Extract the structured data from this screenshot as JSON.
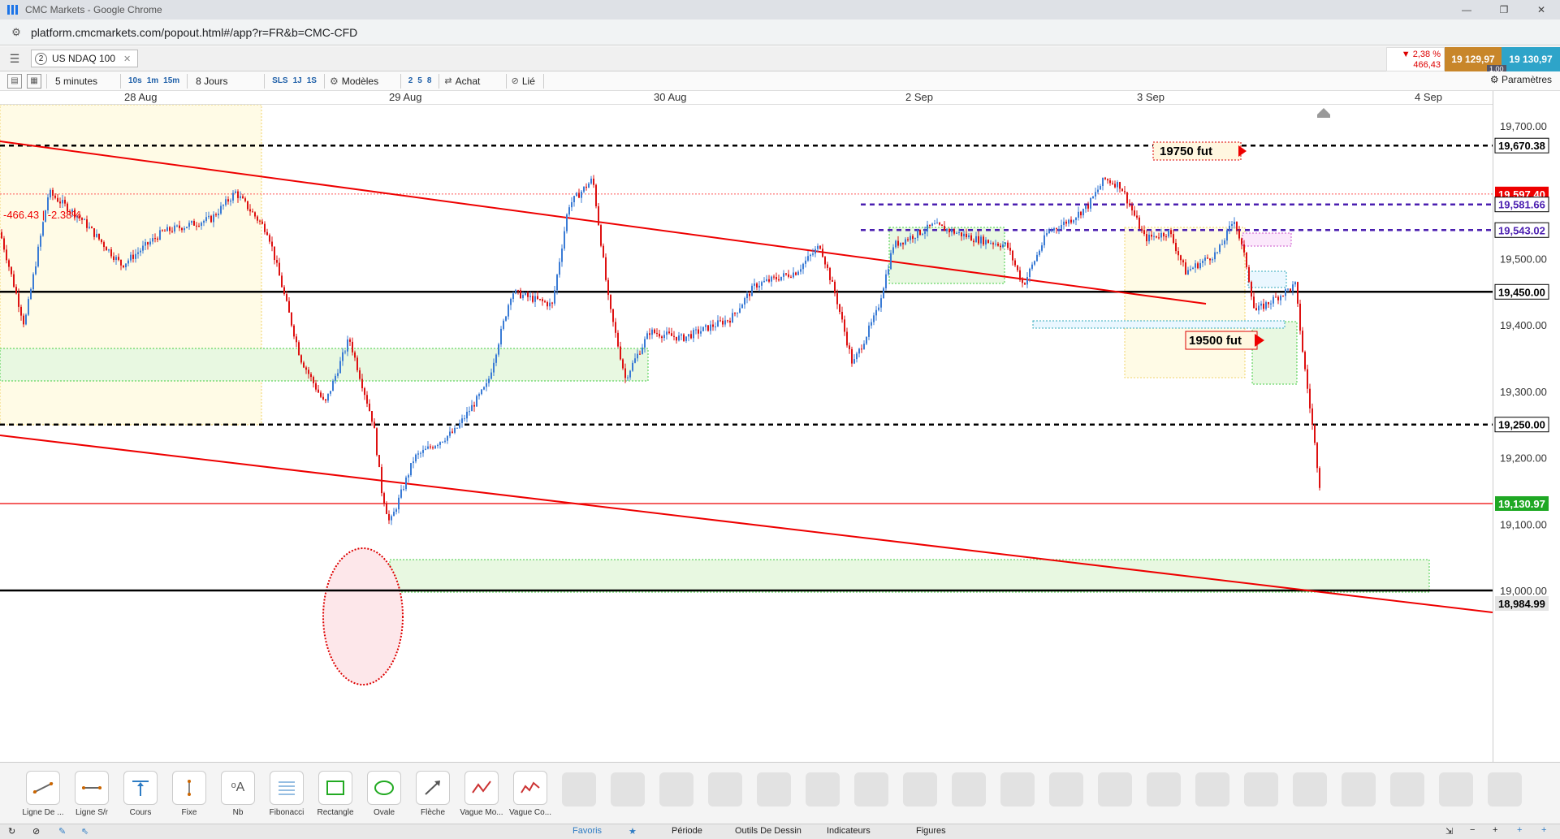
{
  "window": {
    "title": "CMC Markets - Google Chrome"
  },
  "address": {
    "url": "platform.cmcmarkets.com/popout.html#/app?r=FR&b=CMC-CFD"
  },
  "instrument": {
    "tab_number": "2",
    "name": "US NDAQ 100"
  },
  "quote": {
    "change_pct": "▼ 2,38 %",
    "change_abs": "466,43",
    "sell": "19 129,97",
    "buy": "19 130,97",
    "spread": "1.00"
  },
  "toolbar": {
    "interval": "5 minutes",
    "quick_intervals": [
      "10s",
      "1m",
      "15m"
    ],
    "range": "8 Jours",
    "range_quick": [
      "SLS",
      "1J",
      "1S"
    ],
    "models": "Modèles",
    "model_quick": [
      "2",
      "5",
      "8"
    ],
    "buy": "Achat",
    "link": "Lié",
    "settings": "Paramètres"
  },
  "dates": [
    "28 Aug",
    "29 Aug",
    "30 Aug",
    "2 Sep",
    "3 Sep",
    "4 Sep"
  ],
  "chart_data": {
    "type": "candlestick",
    "instrument": "US NDAQ 100",
    "interval": "5 minutes",
    "yticks": [
      "19,700.00",
      "19,500.00",
      "19,400.00",
      "19,300.00",
      "19,200.00",
      "19,100.00",
      "19,000.00"
    ],
    "levels": [
      {
        "label": "19,670.38",
        "value": 19670.38,
        "style": "black-dashed"
      },
      {
        "label": "19,597.40",
        "value": 19597.4,
        "style": "red-tag"
      },
      {
        "label": "19,581.66",
        "value": 19581.66,
        "style": "purple-dashed"
      },
      {
        "label": "19,543.02",
        "value": 19543.02,
        "style": "purple-dashed"
      },
      {
        "label": "19,450.00",
        "value": 19450.0,
        "style": "black-solid"
      },
      {
        "label": "19,250.00",
        "value": 19250.0,
        "style": "black-dashed"
      },
      {
        "label": "19,130.97",
        "value": 19130.97,
        "style": "green-current"
      },
      {
        "label": "18,984.99",
        "value": 18984.99,
        "style": "grey-low"
      }
    ],
    "annotations": [
      {
        "text": "19750  fut",
        "value": 19670.38
      },
      {
        "text": "19500 fut",
        "value": 19450.0
      },
      {
        "text": "-466.43 | -2.38%",
        "value": 19597.4
      }
    ],
    "ylim": [
      18984.99,
      19720
    ]
  },
  "drawing_tools": [
    "Ligne De ...",
    "Ligne S/r",
    "Cours",
    "Fixe",
    "Nb",
    "Fibonacci",
    "Rectangle",
    "Ovale",
    "Flèche",
    "Vague Mo...",
    "Vague Co..."
  ],
  "footer_tabs": [
    "Favoris",
    "Période",
    "Outils De Dessin",
    "Indicateurs",
    "Figures"
  ]
}
